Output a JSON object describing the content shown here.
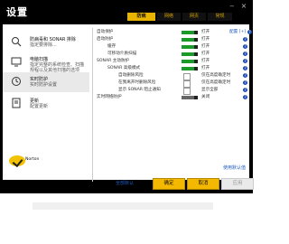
{
  "window": {
    "title": "设置",
    "tabs": [
      "防病",
      "网络",
      "网页",
      "常规"
    ],
    "active_tab_index": 0
  },
  "sidebar": {
    "items": [
      {
        "title": "防病毒和 SONAR 排除",
        "sub": "指定要排除...",
        "icon": "scan-icon"
      },
      {
        "title": "电脑扫描",
        "sub": "指定完整的系统检查、扫描规程以及其他扫描的选项",
        "icon": "computer-icon"
      },
      {
        "title": "实时防护",
        "sub": "实时防护设置",
        "icon": "clock-shield-icon"
      },
      {
        "title": "更新",
        "sub": "配置更新",
        "icon": "update-icon"
      }
    ],
    "active_index": 2
  },
  "rows": [
    {
      "label": "自动保护",
      "indent": 0,
      "state": "打开",
      "link": "配置 [+]",
      "help": true
    },
    {
      "label": "启动防护",
      "indent": 0,
      "state": "打开",
      "help": true
    },
    {
      "label": "缓存",
      "indent": 1,
      "state": "打开",
      "help": true
    },
    {
      "label": "可移动介质扫描",
      "indent": 1,
      "state": "打开",
      "help": true
    },
    {
      "label": "SONAR 主动防护",
      "indent": 0,
      "state": "打开",
      "help": true
    },
    {
      "label": "SONAR 高级模式",
      "indent": 1,
      "state": "打开",
      "help": true
    },
    {
      "label": "自动删除风险",
      "indent": 2,
      "state": "仅在高度确定时",
      "help": true
    },
    {
      "label": "在我离开时删除风险",
      "indent": 2,
      "state": "仅在高度确定时",
      "help": true
    },
    {
      "label": "显示 SONAR 阻止通知",
      "indent": 2,
      "state": "显示全部",
      "help": true
    },
    {
      "label": "实时网络防护",
      "indent": 0,
      "state": "关闭",
      "help": true
    }
  ],
  "footer": {
    "norton_text": "Norton",
    "default_link": "使用默认值",
    "reset_all": "全部默认",
    "ok": "确定",
    "cancel": "取消",
    "apply": "应用"
  }
}
